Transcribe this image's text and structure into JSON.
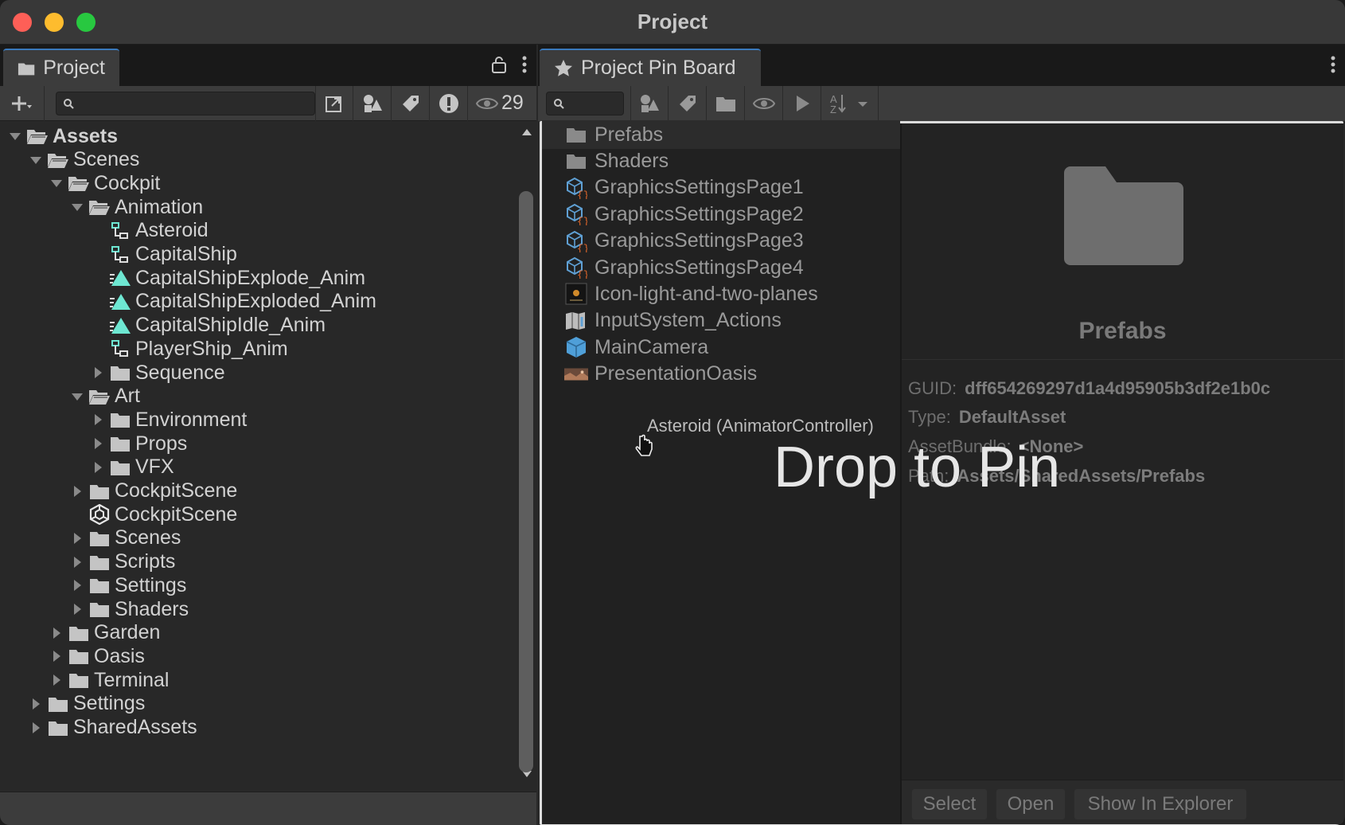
{
  "window": {
    "title": "Project"
  },
  "left_panel": {
    "tab_label": "Project",
    "toolbar": {
      "search_placeholder": "",
      "hidden_count": "29"
    },
    "tree": [
      {
        "label": "Assets",
        "depth": 0,
        "icon": "folder-open-icon",
        "expanded": true,
        "bold": true
      },
      {
        "label": "Scenes",
        "depth": 1,
        "icon": "folder-open-icon",
        "expanded": true
      },
      {
        "label": "Cockpit",
        "depth": 2,
        "icon": "folder-open-icon",
        "expanded": true
      },
      {
        "label": "Animation",
        "depth": 3,
        "icon": "folder-open-icon",
        "expanded": true
      },
      {
        "label": "Asteroid",
        "depth": 4,
        "icon": "animator-controller-icon"
      },
      {
        "label": "CapitalShip",
        "depth": 4,
        "icon": "animator-controller-icon"
      },
      {
        "label": "CapitalShipExplode_Anim",
        "depth": 4,
        "icon": "animation-clip-icon"
      },
      {
        "label": "CapitalShipExploded_Anim",
        "depth": 4,
        "icon": "animation-clip-icon"
      },
      {
        "label": "CapitalShipIdle_Anim",
        "depth": 4,
        "icon": "animation-clip-icon"
      },
      {
        "label": "PlayerShip_Anim",
        "depth": 4,
        "icon": "animator-controller-icon"
      },
      {
        "label": "Sequence",
        "depth": 4,
        "icon": "folder-icon",
        "collapsed": true
      },
      {
        "label": "Art",
        "depth": 3,
        "icon": "folder-open-icon",
        "expanded": true
      },
      {
        "label": "Environment",
        "depth": 4,
        "icon": "folder-icon",
        "collapsed": true
      },
      {
        "label": "Props",
        "depth": 4,
        "icon": "folder-icon",
        "collapsed": true
      },
      {
        "label": "VFX",
        "depth": 4,
        "icon": "folder-icon",
        "collapsed": true
      },
      {
        "label": "CockpitScene",
        "depth": 3,
        "icon": "folder-icon",
        "collapsed": true
      },
      {
        "label": "CockpitScene",
        "depth": 3,
        "icon": "unity-scene-icon"
      },
      {
        "label": "Scenes",
        "depth": 3,
        "icon": "folder-icon",
        "collapsed": true
      },
      {
        "label": "Scripts",
        "depth": 3,
        "icon": "folder-icon",
        "collapsed": true
      },
      {
        "label": "Settings",
        "depth": 3,
        "icon": "folder-icon",
        "collapsed": true
      },
      {
        "label": "Shaders",
        "depth": 3,
        "icon": "folder-icon",
        "collapsed": true
      },
      {
        "label": "Garden",
        "depth": 2,
        "icon": "folder-icon",
        "collapsed": true
      },
      {
        "label": "Oasis",
        "depth": 2,
        "icon": "folder-icon",
        "collapsed": true
      },
      {
        "label": "Terminal",
        "depth": 2,
        "icon": "folder-icon",
        "collapsed": true
      },
      {
        "label": "Settings",
        "depth": 1,
        "icon": "folder-icon",
        "collapsed": true
      },
      {
        "label": "SharedAssets",
        "depth": 1,
        "icon": "folder-icon",
        "collapsed": true
      }
    ]
  },
  "right_panel": {
    "tab_label": "Project Pin Board",
    "pins": [
      {
        "label": "Prefabs",
        "icon": "folder-icon",
        "selected": true
      },
      {
        "label": "Shaders",
        "icon": "folder-icon"
      },
      {
        "label": "GraphicsSettingsPage1",
        "icon": "script-prefab-icon"
      },
      {
        "label": "GraphicsSettingsPage2",
        "icon": "script-prefab-icon"
      },
      {
        "label": "GraphicsSettingsPage3",
        "icon": "script-prefab-icon"
      },
      {
        "label": "GraphicsSettingsPage4",
        "icon": "script-prefab-icon"
      },
      {
        "label": "Icon-light-and-two-planes",
        "icon": "texture-thumbnail-icon"
      },
      {
        "label": "InputSystem_Actions",
        "icon": "input-actions-icon"
      },
      {
        "label": "MainCamera",
        "icon": "prefab-cube-icon"
      },
      {
        "label": "PresentationOasis",
        "icon": "image-thumbnail-icon"
      }
    ],
    "inspector": {
      "name": "Prefabs",
      "guid_label": "GUID:",
      "guid_value": "dff654269297d1a4d95905b3df2e1b0c",
      "type_label": "Type:",
      "type_value": "DefaultAsset",
      "bundle_label": "AssetBundle:",
      "bundle_value": "<None>",
      "path_label": "Path:",
      "path_value": "Assets/SharedAssets/Prefabs",
      "buttons": {
        "select": "Select",
        "open": "Open",
        "show": "Show In Explorer"
      }
    },
    "drag": {
      "item_label": "Asteroid (AnimatorController)",
      "overlay_text": "Drop to Pin"
    }
  },
  "colors": {
    "accent": "#3a79bb",
    "drop_border": "#dcdcdc",
    "anim_clip": "#6ee7d2"
  }
}
